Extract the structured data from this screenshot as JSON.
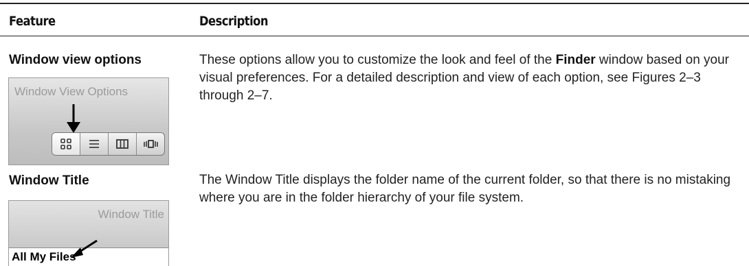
{
  "table": {
    "headers": {
      "feature": "Feature",
      "description": "Description"
    },
    "rows": [
      {
        "feature": "Window view options",
        "description_parts": [
          "These options allow you to customize the look and feel of the ",
          "Finder",
          " window based on your visual preferences. For a detailed description and view of each option, see Figures 2–3 through 2–7."
        ],
        "screenshot": {
          "caption": "Window View Options",
          "buttons": [
            {
              "icon": "icon-view-icon",
              "active": true
            },
            {
              "icon": "list-view-icon",
              "active": false
            },
            {
              "icon": "column-view-icon",
              "active": false
            },
            {
              "icon": "cover-flow-view-icon",
              "active": false
            }
          ]
        }
      },
      {
        "feature": "Window Title",
        "description": "The Window Title displays the folder name of the current folder, so that there is no mistaking where you are in the folder hierarchy of your file system.",
        "screenshot": {
          "caption": "Window Title",
          "title_text": "All My Files"
        }
      }
    ]
  }
}
